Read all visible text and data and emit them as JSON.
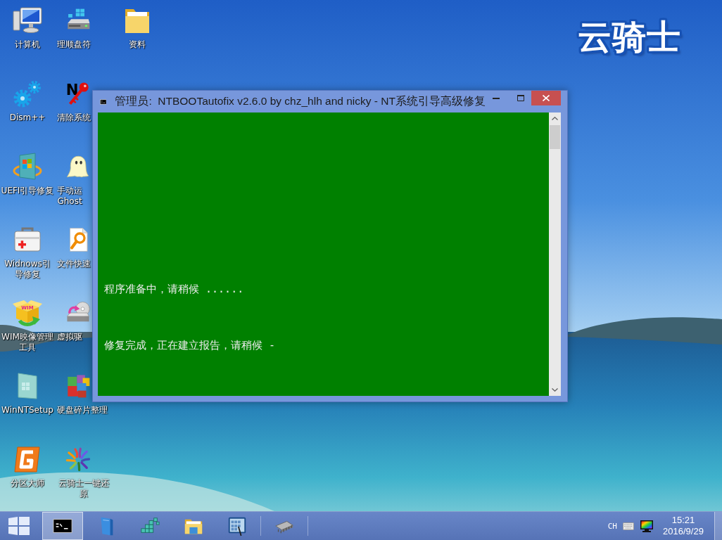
{
  "desktop": {
    "columns": [
      {
        "icons": [
          {
            "label": "计算机"
          },
          {
            "label": "Dism++"
          },
          {
            "label": "UEFI引导修复"
          },
          {
            "label": "Widnows引导修复"
          },
          {
            "label": "WIM映像管理工具",
            "icon_text": "WIM"
          },
          {
            "label": "WinNTSetup"
          },
          {
            "label": "分区大师"
          }
        ]
      },
      {
        "icons": [
          {
            "label": "理顺盘符"
          },
          {
            "label": "清除系统",
            "icon_text": "N"
          },
          {
            "label": "手动运\nGhost"
          },
          {
            "label": "文件快速"
          },
          {
            "label": "虚拟驱"
          },
          {
            "label": "硬盘碎片整理"
          },
          {
            "label": "云骑士一键还原"
          }
        ]
      },
      {
        "icons": [
          {
            "label": "资料"
          }
        ]
      }
    ]
  },
  "logo": {
    "text": "云骑士"
  },
  "window": {
    "title": "管理员:  NTBOOTautofix v2.6.0 by chz_hlh and nicky - NT系统引导高级修复",
    "console_lines": [
      "程序准备中，请稍候 ......",
      "修复完成，正在建立报告，请稍候 -"
    ]
  },
  "taskbar": {
    "apps": [
      {
        "selected": true
      },
      {
        "selected": false
      },
      {
        "selected": false
      },
      {
        "selected": false
      },
      {
        "selected": false
      },
      {
        "selected": false
      }
    ],
    "tray": {
      "language": "CH",
      "time": "15:21",
      "date": "2016/9/29"
    }
  }
}
